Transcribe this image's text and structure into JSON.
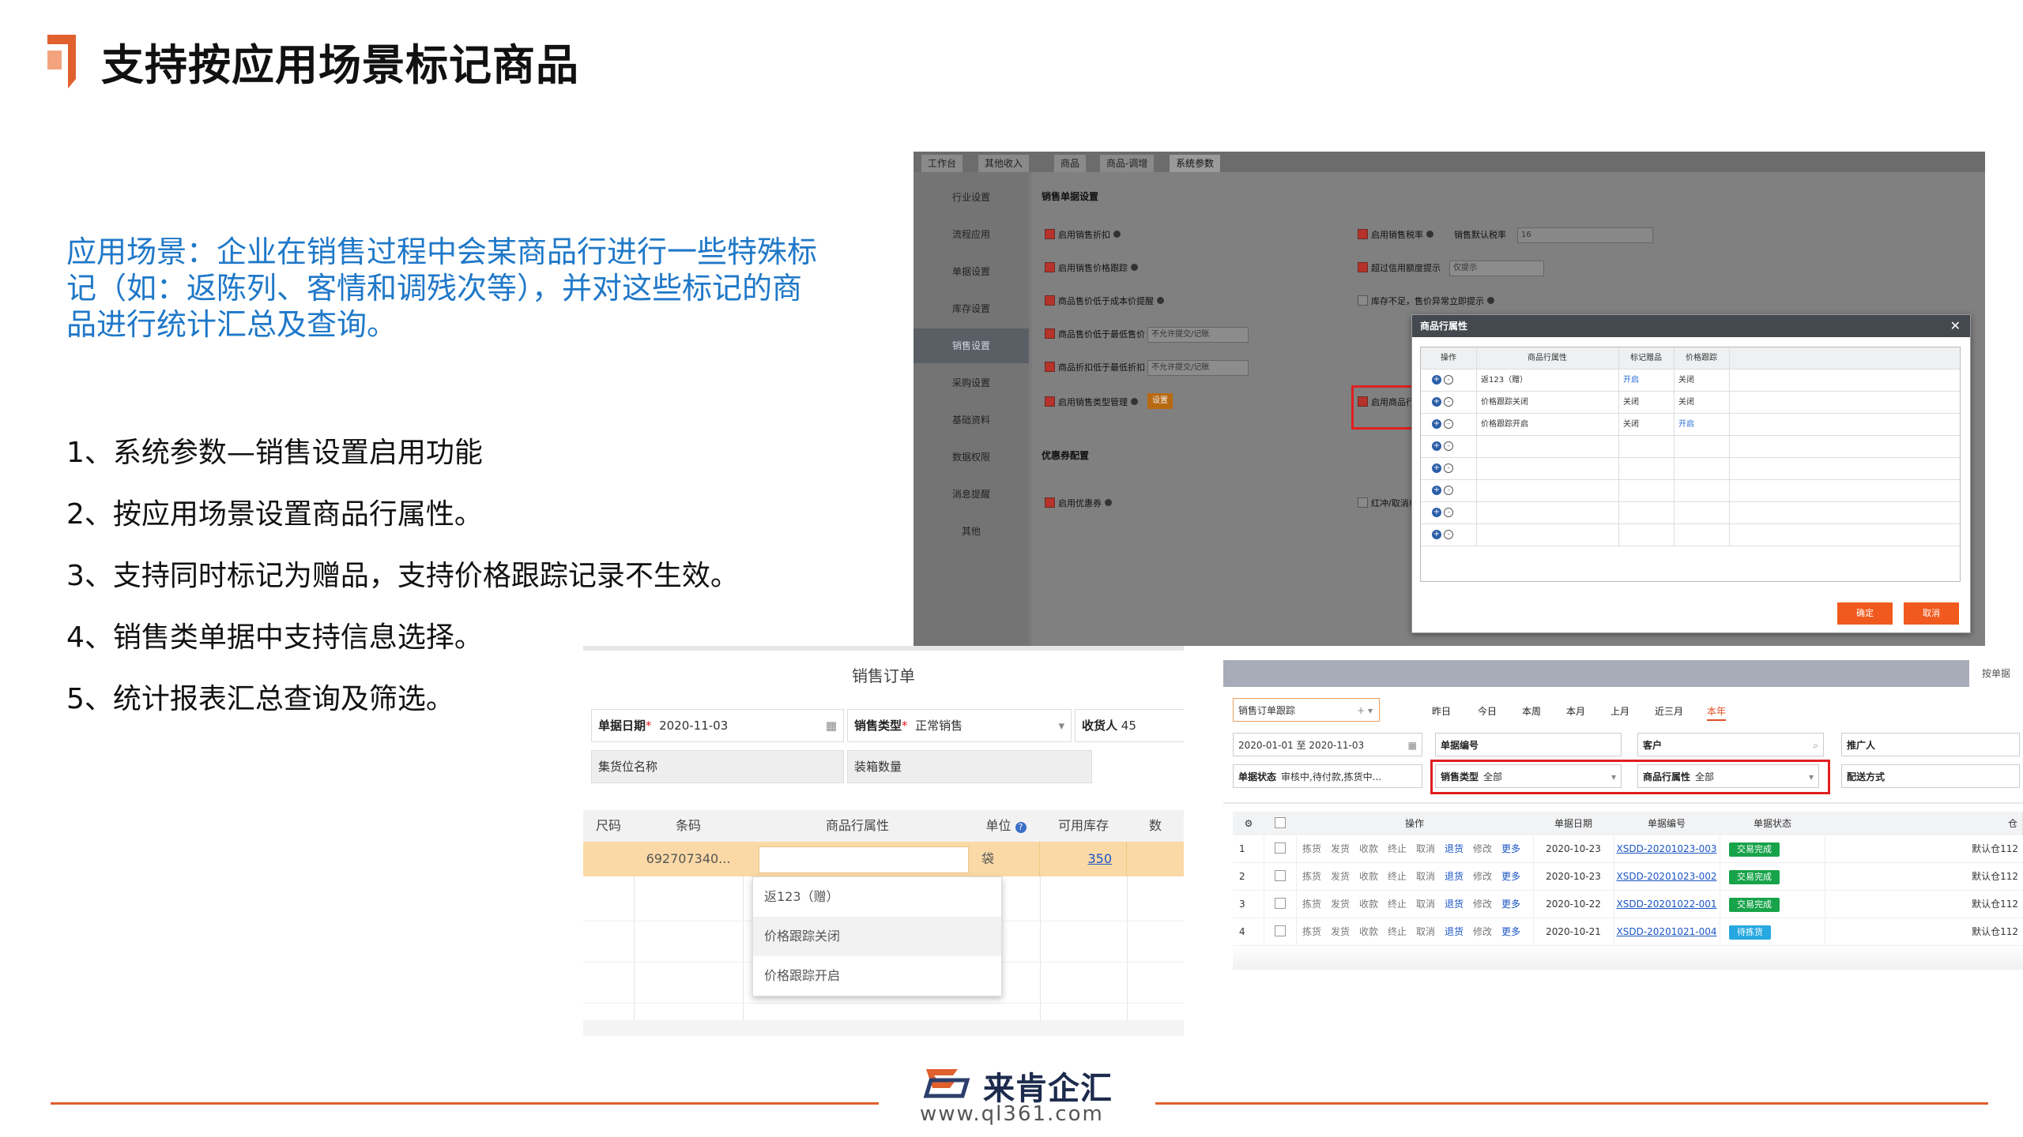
{
  "slide": {
    "title": "支持按应用场景标记商品",
    "intro": "应用场景：企业在销售过程中会某商品行进行一些特殊标记（如：返陈列、客情和调残次等），并对这些标记的商品进行统计汇总及查询。",
    "steps": [
      "1、系统参数—销售设置启用功能",
      "2、按应用场景设置商品行属性。",
      "3、支持同时标记为赠品，支持价格跟踪记录不生效。",
      "4、销售类单据中支持信息选择。",
      "5、统计报表汇总查询及筛选。"
    ],
    "accent_color": "#e0602e",
    "intro_color": "#1f78c8"
  },
  "settings_screen": {
    "tabs": [
      "工作台",
      "其他收入",
      "商品",
      "商品-调增",
      "系统参数"
    ],
    "sidebar": [
      "行业设置",
      "流程应用",
      "单据设置",
      "库存设置",
      "销售设置",
      "采购设置",
      "基础资料",
      "数据权限",
      "消息提醒",
      "其他"
    ],
    "active_sidebar": "销售设置",
    "section_sales": "销售单据设置",
    "section_promo": "优惠券配置",
    "options_left": [
      "启用销售折扣",
      "启用销售价格跟踪",
      "商品售价低于成本价提醒",
      "商品售价低于最低售价",
      "商品折扣低于最低折扣",
      "启用销售类型管理"
    ],
    "options_right": [
      "启用销售税率",
      "超过信用额度提示",
      "库存不足，售价异常立即提示",
      "启用商品行属性管理"
    ],
    "tax_label": "销售默认税率",
    "tax_value": "16",
    "credit_select": "仅提示",
    "price_select_1": "不允许提交/记账",
    "price_select_2": "不允许提交/记账",
    "setup_button": "设置",
    "promo_left": "启用优惠券",
    "promo_right": "红冲/取消单据退回优惠券"
  },
  "dialog": {
    "title": "商品行属性",
    "close": "✕",
    "columns": [
      "操作",
      "商品行属性",
      "标记赠品",
      "价格跟踪"
    ],
    "rows": [
      {
        "name": "返123（赠）",
        "gift": "开启",
        "track": "关闭"
      },
      {
        "name": "价格跟踪关闭",
        "gift": "关闭",
        "track": "关闭"
      },
      {
        "name": "价格跟踪开启",
        "gift": "关闭",
        "track": "开启"
      }
    ],
    "empty_rows": 5,
    "ok": "确定",
    "cancel": "取消"
  },
  "sales_order": {
    "title": "销售订单",
    "date_label": "单据日期",
    "date_value": "2020-11-03",
    "type_label": "销售类型",
    "type_value": "正常销售",
    "receiver_label": "收货人",
    "receiver_value": "45",
    "location_placeholder": "集货位名称",
    "qty_placeholder": "装箱数量",
    "columns": [
      "尺码",
      "条码",
      "商品行属性",
      "单位",
      "可用库存",
      "数"
    ],
    "row": {
      "barcode": "692707340...",
      "unit": "袋",
      "stock": "350"
    },
    "dropdown": [
      "返123（赠）",
      "价格跟踪关闭",
      "价格跟踪开启"
    ]
  },
  "report": {
    "right_tab": "按单据",
    "report_select": "销售订单跟踪",
    "quick_dates": [
      "昨日",
      "今日",
      "本周",
      "本月",
      "上月",
      "近三月",
      "本年"
    ],
    "active_date": "本年",
    "date_from": "2020-01-01",
    "date_sep": "至",
    "date_to": "2020-11-03",
    "f_number": "单据编号",
    "f_customer": "客户",
    "f_promoter": "推广人",
    "f_status_label": "单据状态",
    "f_status_value": "审核中,待付款,拣货中...",
    "f_type_label": "销售类型",
    "f_type_value": "全部",
    "f_attr_label": "商品行属性",
    "f_attr_value": "全部",
    "f_delivery": "配送方式",
    "columns": [
      "操作",
      "单据日期",
      "单据编号",
      "单据状态",
      "仓"
    ],
    "actions": [
      "拣货",
      "发货",
      "收款",
      "终止",
      "取消",
      "退货",
      "修改",
      "更多"
    ],
    "rows": [
      {
        "no": "1",
        "date": "2020-10-23",
        "code": "XSDD-20201023-003",
        "status": "交易完成",
        "status_color": "#17a34a",
        "wh": "默认仓112"
      },
      {
        "no": "2",
        "date": "2020-10-23",
        "code": "XSDD-20201023-002",
        "status": "交易完成",
        "status_color": "#17a34a",
        "wh": "默认仓112"
      },
      {
        "no": "3",
        "date": "2020-10-22",
        "code": "XSDD-20201022-001",
        "status": "交易完成",
        "status_color": "#17a34a",
        "wh": "默认仓112"
      },
      {
        "no": "4",
        "date": "2020-10-21",
        "code": "XSDD-20201021-004",
        "status": "待拣货",
        "status_color": "#26a8e0",
        "wh": "默认仓112"
      }
    ]
  },
  "footer": {
    "brand": "来肯企汇",
    "url": "www.ql361.com"
  }
}
